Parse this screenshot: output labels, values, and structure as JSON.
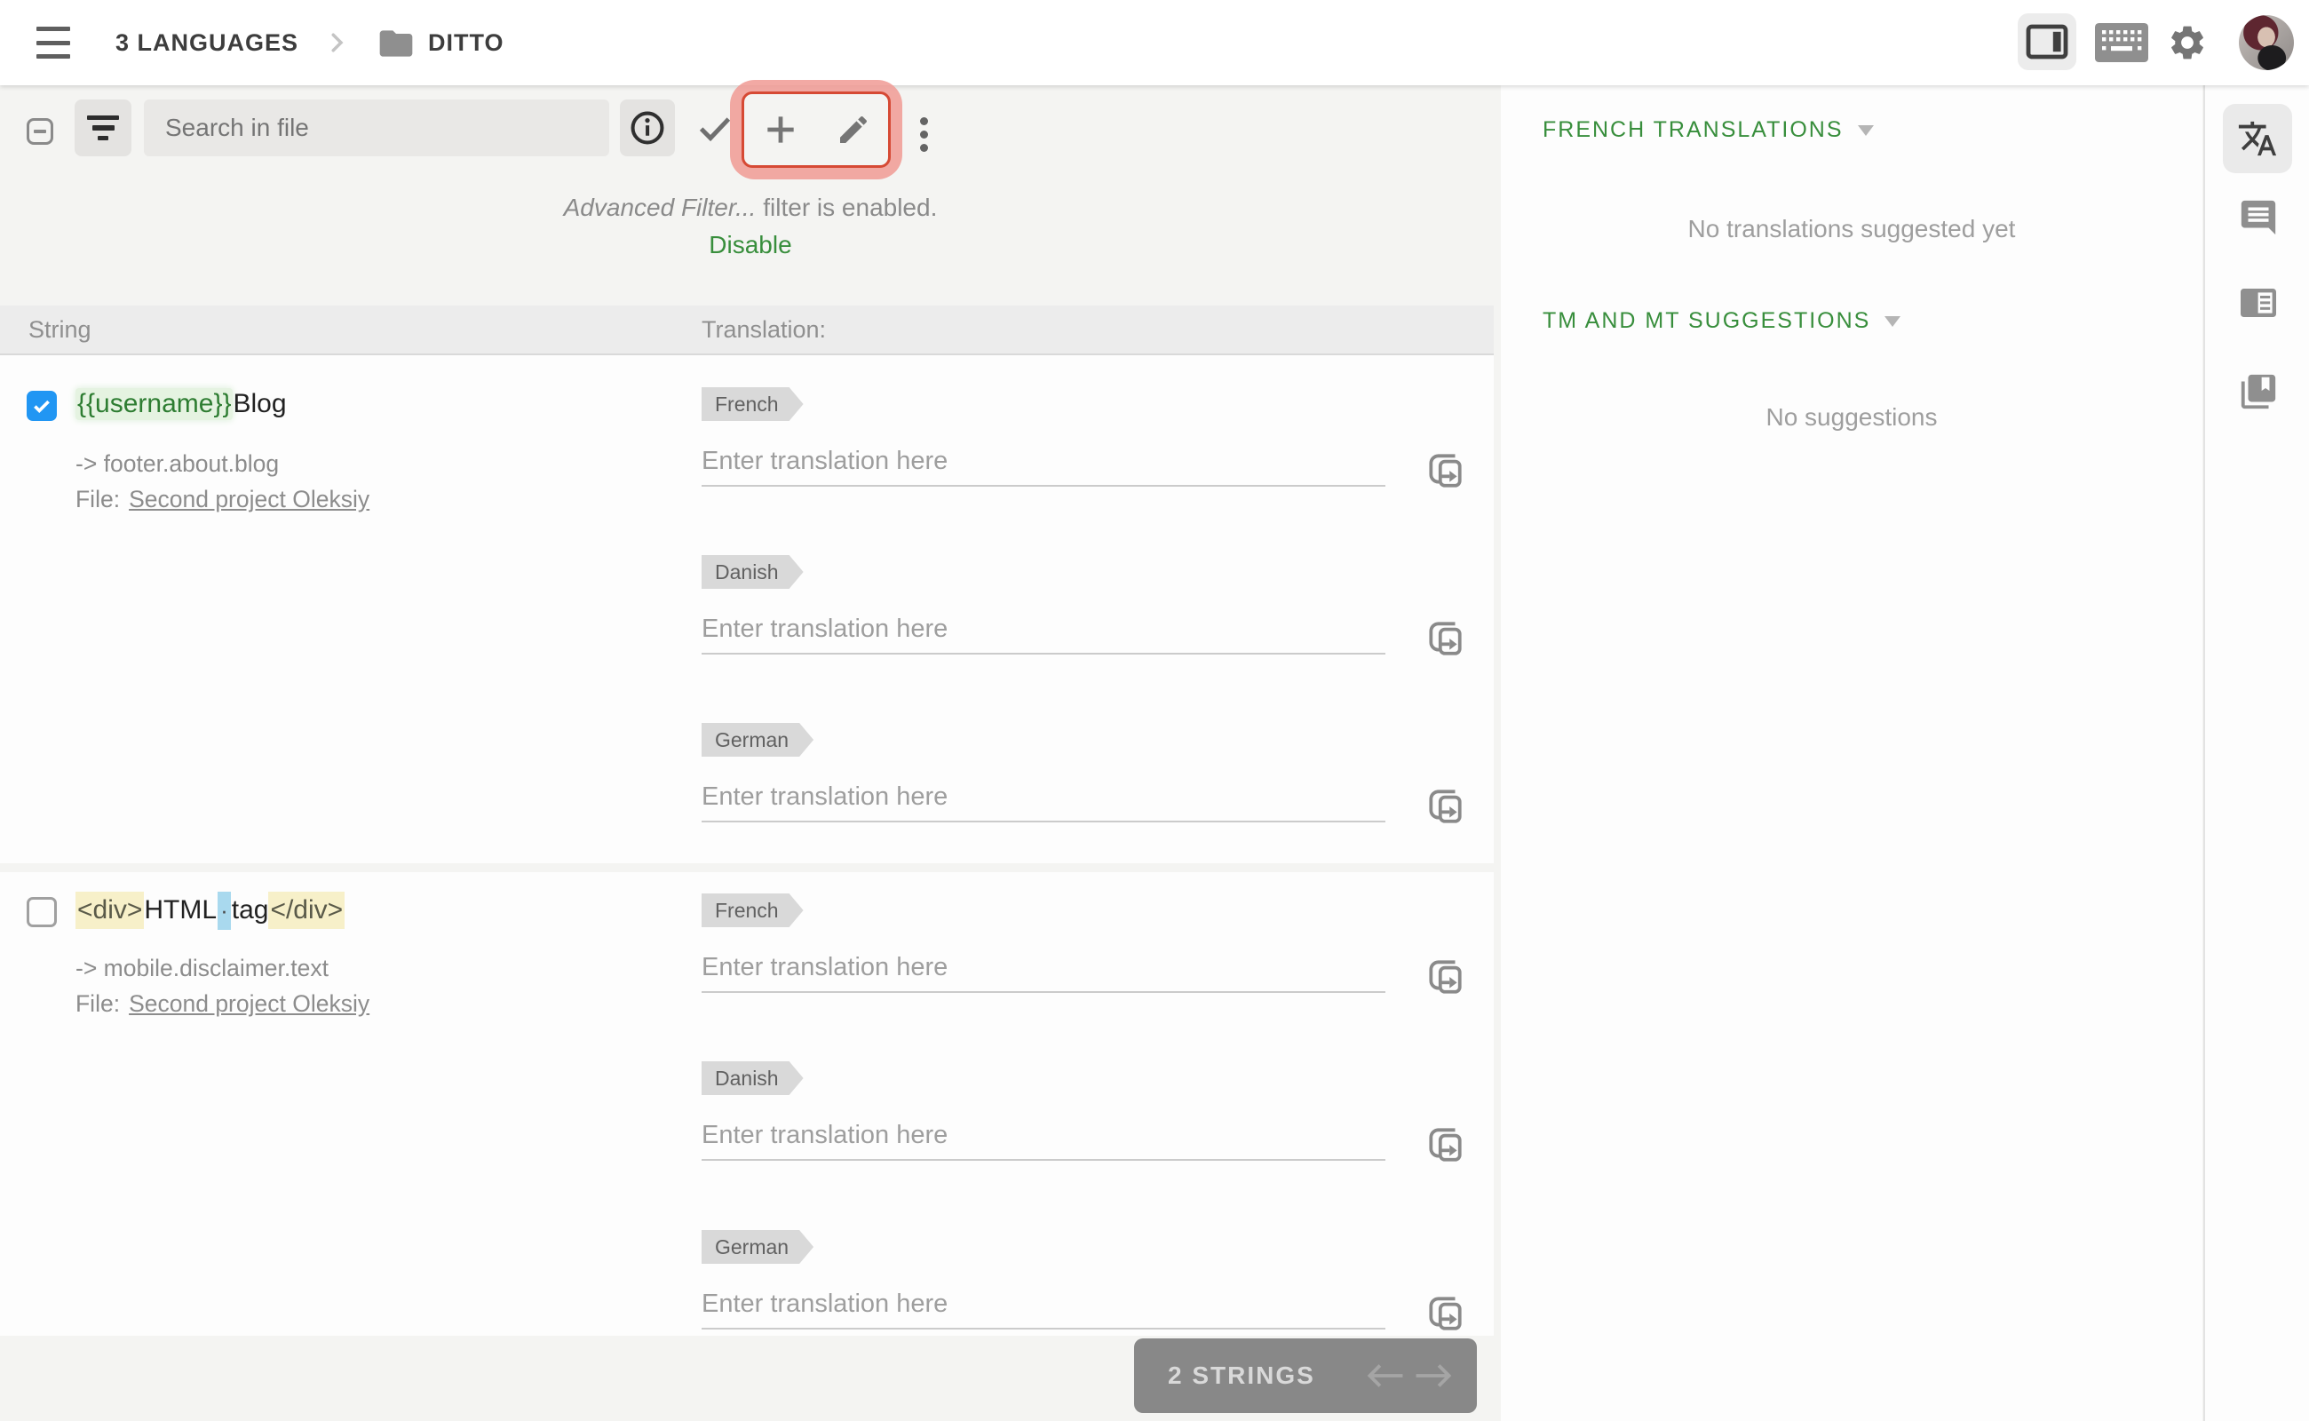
{
  "topbar": {
    "breadcrumb_root": "3 LANGUAGES",
    "breadcrumb_current": "DITTO"
  },
  "toolbar": {
    "search_placeholder": "Search in file",
    "filter_notice_name": "Advanced Filter...",
    "filter_notice_suffix": " filter is enabled.",
    "disable_label": "Disable"
  },
  "list_header": {
    "string_col": "String",
    "translation_col": "Translation:"
  },
  "strings": [
    {
      "selected": true,
      "text_variable": "{{username}}",
      "text_plain": "Blog",
      "key": "-> footer.about.blog",
      "file_label": "File:",
      "file_link": "Second project Oleksiy",
      "translations": [
        {
          "language": "French",
          "placeholder": "Enter translation here"
        },
        {
          "language": "Danish",
          "placeholder": "Enter translation here"
        },
        {
          "language": "German",
          "placeholder": "Enter translation here"
        }
      ]
    },
    {
      "selected": false,
      "tag_open": "<div>",
      "text_word1": "HTML",
      "space_marker": "·",
      "text_word2": "tag",
      "tag_close": "</div>",
      "key": "-> mobile.disclaimer.text",
      "file_label": "File:",
      "file_link": "Second project Oleksiy",
      "translations": [
        {
          "language": "French",
          "placeholder": "Enter translation here"
        },
        {
          "language": "Danish",
          "placeholder": "Enter translation here"
        },
        {
          "language": "German",
          "placeholder": "Enter translation here"
        }
      ]
    }
  ],
  "footer": {
    "count_label": "2 STRINGS"
  },
  "right_panel": {
    "sections": [
      {
        "title": "FRENCH TRANSLATIONS",
        "empty_message": "No translations suggested yet"
      },
      {
        "title": "TM AND MT SUGGESTIONS",
        "empty_message": "No suggestions"
      }
    ]
  },
  "icons": [
    "menu-icon",
    "folder-icon",
    "breadcrumb-chevron-icon",
    "panel-toggle-icon",
    "keyboard-icon",
    "settings-icon",
    "filter-icon",
    "info-icon",
    "approve-check-icon",
    "add-icon",
    "edit-icon",
    "kebab-menu-icon",
    "copy-source-icon",
    "translate-icon",
    "comment-icon",
    "reader-icon",
    "collections-bookmark-icon",
    "arrow-left-icon",
    "arrow-right-icon"
  ],
  "colors": {
    "accent_green": "#388e3c",
    "checkbox_blue": "#2196f3",
    "annotation_red": "#d64a35",
    "annotation_halo": "#f09a94",
    "variable_green": "#2e7d32",
    "variable_bg": "#e5f3e1",
    "html_tag_bg": "#f7f0c9",
    "space_marker_bg": "#a9d9ee",
    "language_tag_bg": "#d9d9d9"
  }
}
